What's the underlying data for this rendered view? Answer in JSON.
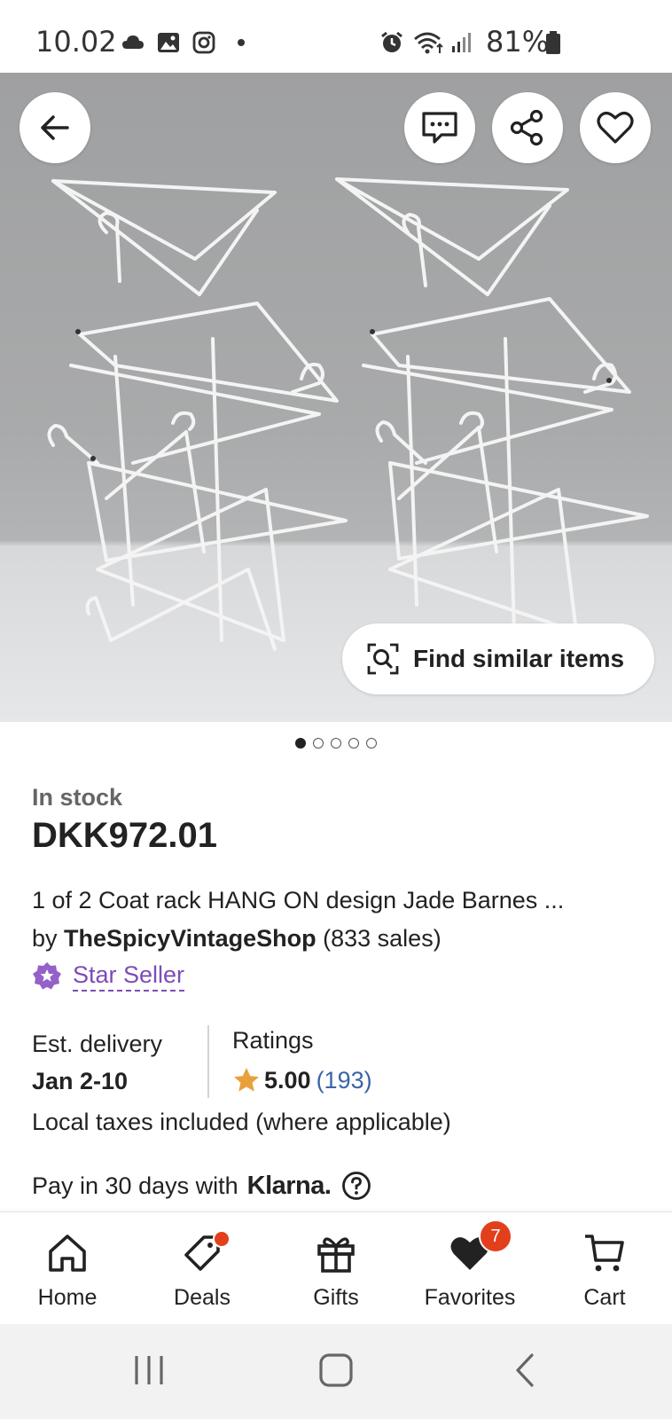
{
  "status_bar": {
    "time": "10.02",
    "battery": "81%",
    "icons": [
      "cloud-icon",
      "image-icon",
      "instagram-icon",
      "dot-icon",
      "alarm-icon",
      "wifi-icon",
      "signal-icon",
      "battery-icon"
    ]
  },
  "hero": {
    "find_similar_label": "Find similar items",
    "carousel": {
      "count": 5,
      "active": 0
    }
  },
  "product": {
    "stock": "In stock",
    "price": "DKK972.01",
    "title": "1 of 2 Coat rack HANG ON design Jade Barnes ...",
    "seller_prefix": "by",
    "seller_name": "TheSpicyVintageShop",
    "seller_sales": "(833 sales)",
    "star_seller_label": "Star Seller",
    "delivery_label": "Est. delivery",
    "delivery_value": "Jan 2-10",
    "ratings_label": "Ratings",
    "rating_score": "5.00",
    "rating_count": "(193)",
    "taxes": "Local taxes included (where applicable)",
    "pay_label": "Pay in 30 days with",
    "klarna_brand": "Klarna."
  },
  "bottom_nav": {
    "items": [
      {
        "label": "Home",
        "icon": "home-icon"
      },
      {
        "label": "Deals",
        "icon": "deals-tag-icon"
      },
      {
        "label": "Gifts",
        "icon": "gift-icon"
      },
      {
        "label": "Favorites",
        "icon": "heart-icon",
        "badge": "7"
      },
      {
        "label": "Cart",
        "icon": "cart-icon"
      }
    ]
  },
  "colors": {
    "star_seller": "#7c4cb8",
    "rating_star": "#e8a13a",
    "rating_count": "#3a64a8",
    "badge": "#e2401c"
  }
}
